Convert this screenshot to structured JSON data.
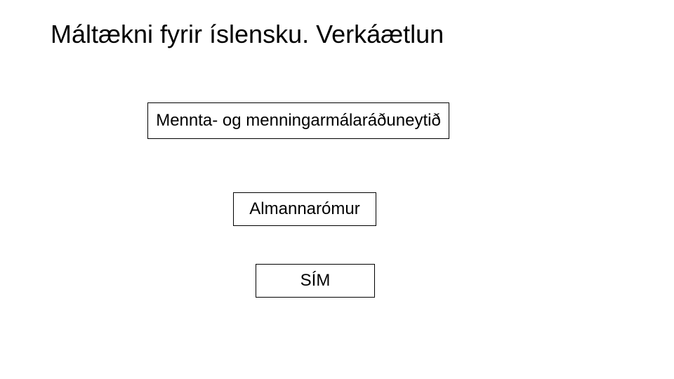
{
  "title": "Máltækni fyrir íslensku. Verkáætlun",
  "boxes": {
    "box1": "Mennta- og menningarmálaráðuneytið",
    "box2": "Almannarómur",
    "box3": "SÍM"
  }
}
